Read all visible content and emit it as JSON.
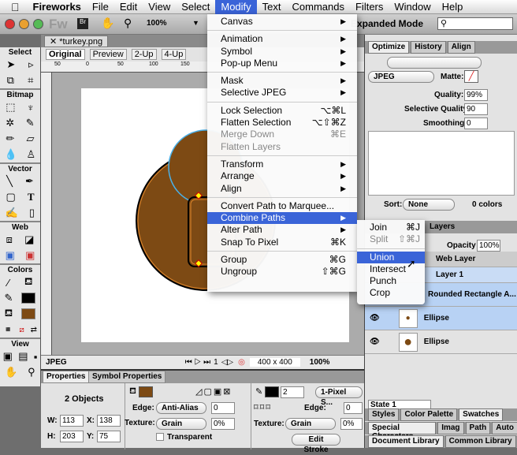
{
  "menubar": {
    "app": "Fireworks",
    "items": [
      "File",
      "Edit",
      "View",
      "Select",
      "Modify",
      "Text",
      "Commands",
      "Filters",
      "Window",
      "Help"
    ]
  },
  "toolbar": {
    "zoom": "100%",
    "mode": "Expanded Mode",
    "search_placeholder": ""
  },
  "document": {
    "tab": "*turkey.png",
    "views": [
      "Original",
      "Preview",
      "2-Up",
      "4-Up"
    ],
    "ruler_marks": [
      "50",
      "0",
      "50",
      "100",
      "150"
    ],
    "status_format": "JPEG",
    "frame": "1",
    "size": "400 x 400",
    "zoom": "100%"
  },
  "tools": {
    "sections": [
      "Select",
      "Bitmap",
      "Vector",
      "Web",
      "Colors",
      "View"
    ]
  },
  "modify_menu": [
    [
      {
        "label": "Canvas",
        "sub": true
      }
    ],
    [
      {
        "label": "Animation",
        "sub": true
      },
      {
        "label": "Symbol",
        "sub": true
      },
      {
        "label": "Pop-up Menu",
        "sub": true
      }
    ],
    [
      {
        "label": "Mask",
        "sub": true
      },
      {
        "label": "Selective JPEG",
        "sub": true
      }
    ],
    [
      {
        "label": "Lock Selection",
        "key": "⌥⌘L"
      },
      {
        "label": "Flatten Selection",
        "key": "⌥⇧⌘Z"
      },
      {
        "label": "Merge Down",
        "key": "⌘E",
        "disabled": true
      },
      {
        "label": "Flatten Layers",
        "disabled": true
      }
    ],
    [
      {
        "label": "Transform",
        "sub": true
      },
      {
        "label": "Arrange",
        "sub": true
      },
      {
        "label": "Align",
        "sub": true
      }
    ],
    [
      {
        "label": "Convert Path to Marquee..."
      },
      {
        "label": "Combine Paths",
        "sub": true,
        "highlighted": true
      },
      {
        "label": "Alter Path",
        "sub": true
      },
      {
        "label": "Snap To Pixel",
        "key": "⌘K"
      }
    ],
    [
      {
        "label": "Group",
        "key": "⌘G"
      },
      {
        "label": "Ungroup",
        "key": "⇧⌘G"
      }
    ]
  ],
  "combine_submenu": [
    [
      {
        "label": "Join",
        "key": "⌘J"
      },
      {
        "label": "Split",
        "key": "⇧⌘J",
        "disabled": true
      }
    ],
    [
      {
        "label": "Union",
        "highlighted": true
      },
      {
        "label": "Intersect"
      },
      {
        "label": "Punch"
      },
      {
        "label": "Crop"
      }
    ]
  ],
  "optimize": {
    "tabs": [
      "Optimize",
      "History",
      "Align"
    ],
    "format": "JPEG",
    "matte_label": "Matte:",
    "quality_label": "Quality:",
    "quality": "99%",
    "selq_label": "Selective Quality:",
    "selq": "90",
    "smooth_label": "Smoothing:",
    "smooth": "0",
    "sort_label": "Sort:",
    "sort": "None",
    "colors": "0 colors"
  },
  "layers": {
    "tab": "Layers",
    "opacity_label": "Opacity",
    "opacity": "100%",
    "rows": [
      "Web Layer",
      "Layer 1",
      "Rounded Rectangle A...",
      "Ellipse",
      "Ellipse"
    ],
    "state": "State 1"
  },
  "panels": {
    "row1": [
      "Styles",
      "Color Palette",
      "Swatches"
    ],
    "row2": [
      "Special Characters",
      "Imag",
      "Path",
      "Auto"
    ],
    "row3": [
      "Document Library",
      "Common Library"
    ]
  },
  "properties": {
    "tabs": [
      "Properties",
      "Symbol Properties"
    ],
    "objects": "2 Objects",
    "w_label": "W:",
    "w": "113",
    "x_label": "X:",
    "x": "138",
    "h_label": "H:",
    "h": "203",
    "y_label": "Y:",
    "y": "75",
    "edge_label": "Edge:",
    "edge": "Anti-Alias",
    "edge_val": "0",
    "texture_label": "Texture:",
    "texture": "Grain",
    "texture_val": "0%",
    "transparent": "Transparent",
    "stroke_size": "2",
    "stroke_type": "1-Pixel S...",
    "stroke_edge_val": "0",
    "stroke_texture": "Grain",
    "stroke_texture_val": "0%",
    "edit_stroke": "Edit Stroke"
  },
  "colors": {
    "fill": "#7d4a14",
    "stroke": "#000000",
    "accent": "#3a64d8"
  }
}
